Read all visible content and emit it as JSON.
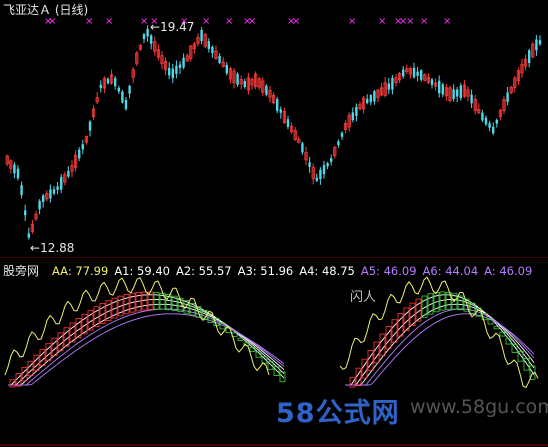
{
  "window": {
    "title": "飞亚达Ａ (日线)",
    "indicator_name": "股旁网"
  },
  "price_chart": {
    "high_label": "19.47",
    "low_label": "12.88",
    "signal_marker": "×",
    "colors": {
      "up": "#ff3b3b",
      "down": "#4fd9e8",
      "signal": "#ff33ff",
      "background": "#000000"
    }
  },
  "indicator": {
    "readout": [
      {
        "label": "AA:",
        "value": "77.99",
        "color": "#f0f070"
      },
      {
        "label": "A1:",
        "value": "59.40",
        "color": "#ffffff"
      },
      {
        "label": "A2:",
        "value": "55.57",
        "color": "#ffffff"
      },
      {
        "label": "A3:",
        "value": "51.96",
        "color": "#ffffff"
      },
      {
        "label": "A4:",
        "value": "48.75",
        "color": "#ffffff"
      },
      {
        "label": "A5:",
        "value": "46.09",
        "color": "#b77cff"
      },
      {
        "label": "A6:",
        "value": "44.04",
        "color": "#b77cff"
      },
      {
        "label": "A:",
        "value": "46.09",
        "color": "#b77cff"
      }
    ],
    "overlay_text": "闪人",
    "colors": {
      "aa": "#f0f070",
      "band_up": "#ff3b3b",
      "band_down": "#3fd23f",
      "ma_lines": "#ffffff",
      "ma_purple": "#b77cff"
    }
  },
  "watermark": {
    "text": "58公式网",
    "url": "www.58gu.com"
  }
}
